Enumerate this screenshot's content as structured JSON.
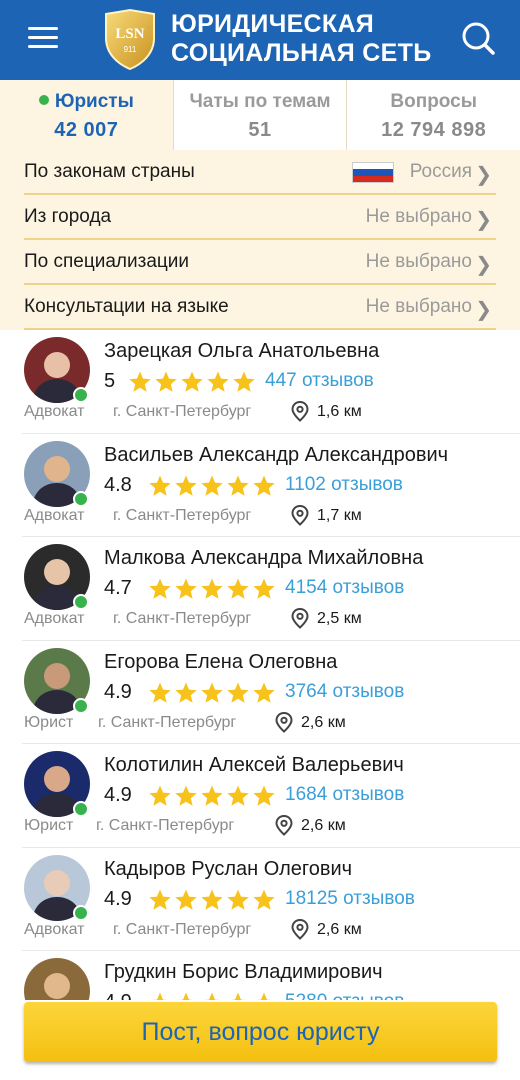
{
  "header": {
    "brand_line1": "ЮРИДИЧЕСКАЯ",
    "brand_line2": "СОЦИАЛЬНАЯ СЕТЬ",
    "logo_text": "LSN",
    "logo_sub": "911"
  },
  "tabs": [
    {
      "title": "Юристы",
      "count": "42 007",
      "active": true
    },
    {
      "title": "Чаты по темам",
      "count": "51",
      "active": false
    },
    {
      "title": "Вопросы",
      "count": "12 794 898",
      "active": false
    }
  ],
  "filters": [
    {
      "label": "По законам страны",
      "value": "Россия"
    },
    {
      "label": "Из города",
      "value": "Не выбрано"
    },
    {
      "label": "По специализации",
      "value": "Не выбрано"
    },
    {
      "label": "Консультации на языке",
      "value": "Не выбрано"
    }
  ],
  "lawyers": [
    {
      "name": "Зарецкая Ольга Анатольевна",
      "rating": "5",
      "reviews": "447 отзывов",
      "role": "Адвокат",
      "city": "г. Санкт-Петербург",
      "distance": "1,6 км"
    },
    {
      "name": "Васильев Александр Александрович",
      "rating": "4.8",
      "reviews": "1102 отзывов",
      "role": "Адвокат",
      "city": "г. Санкт-Петербург",
      "distance": "1,7 км"
    },
    {
      "name": "Малкова Александра Михайловна",
      "rating": "4.7",
      "reviews": "4154 отзывов",
      "role": "Адвокат",
      "city": "г. Санкт-Петербург",
      "distance": "2,5 км"
    },
    {
      "name": "Егорова Елена Олеговна",
      "rating": "4.9",
      "reviews": "3764 отзывов",
      "role": "Юрист",
      "city": "г. Санкт-Петербург",
      "distance": "2,6 км"
    },
    {
      "name": "Колотилин Алексей Валерьевич",
      "rating": "4.9",
      "reviews": "1684 отзывов",
      "role": "Юрист",
      "city": "г. Санкт-Петербург",
      "distance": "2,6 км"
    },
    {
      "name": "Кадыров Руслан Олегович",
      "rating": "4.9",
      "reviews": "18125 отзывов",
      "role": "Адвокат",
      "city": "г. Санкт-Петербург",
      "distance": "2,6 км"
    },
    {
      "name": "Грудкин Борис Владимирович",
      "rating": "4.9",
      "reviews": "5280 отзывов",
      "role": "",
      "city": "",
      "distance": ""
    }
  ],
  "cta": {
    "label": "Пост, вопрос юристу"
  },
  "colors": {
    "header": "#1e64b4",
    "star": "#f7c21a",
    "online": "#37b24d",
    "link": "#3a9fd8",
    "cta": "#f7c825"
  }
}
